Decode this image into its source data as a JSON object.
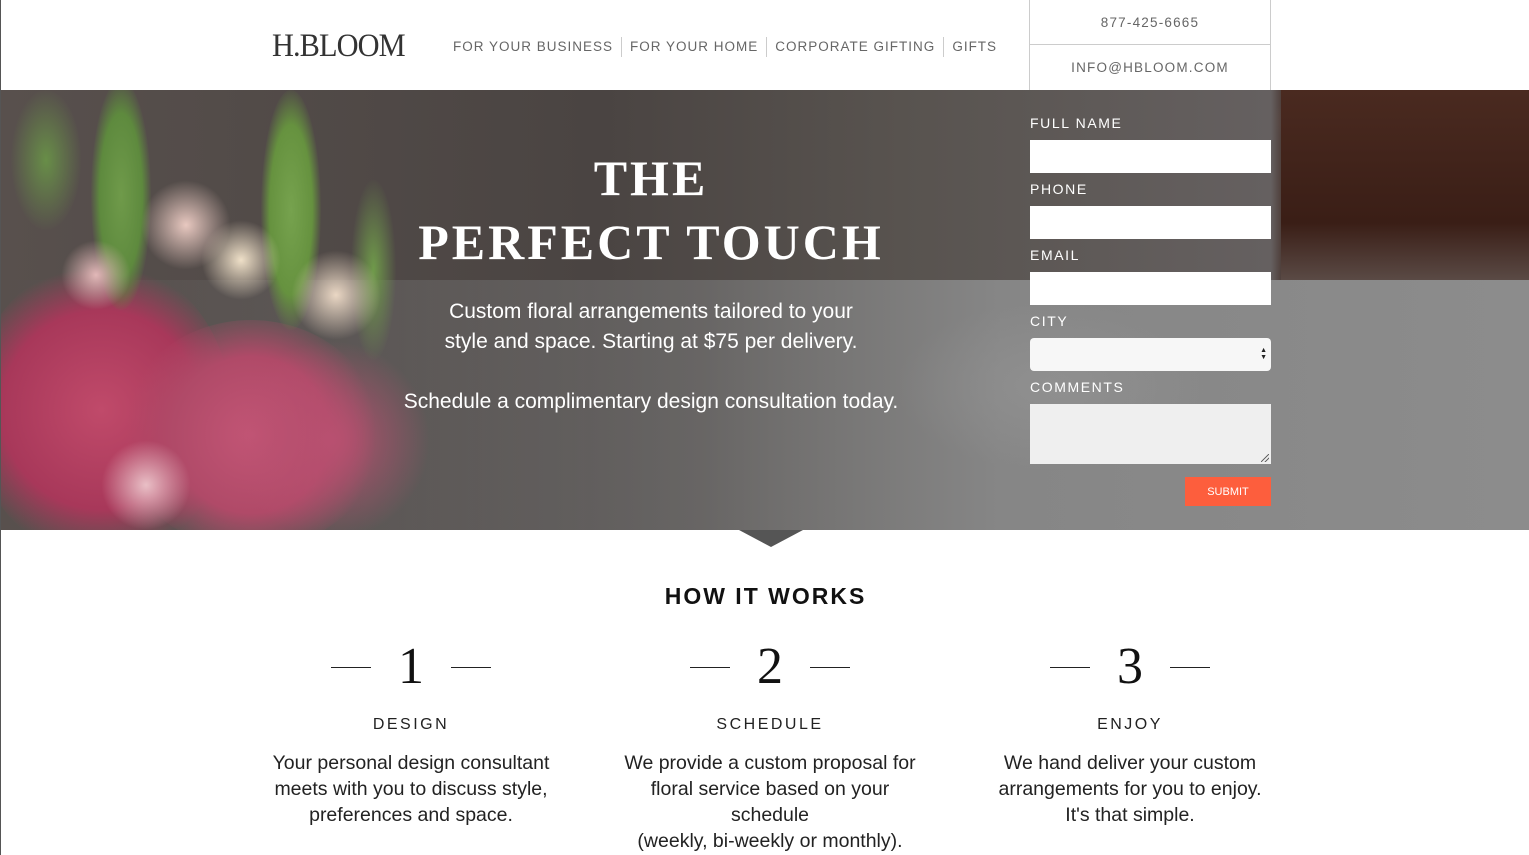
{
  "header": {
    "logo": "H.BLOOM",
    "nav": [
      "FOR YOUR BUSINESS",
      "FOR YOUR HOME",
      "CORPORATE GIFTING",
      "GIFTS"
    ],
    "phone": "877-425-6665",
    "email": "INFO@HBLOOM.COM"
  },
  "hero": {
    "title_line1": "THE",
    "title_line2": "PERFECT TOUCH",
    "text1_line1": "Custom floral arrangements tailored to your",
    "text1_line2": "style and space. Starting at $75 per delivery.",
    "text2": "Schedule a complimentary design consultation today."
  },
  "form": {
    "full_name_label": "FULL NAME",
    "full_name_value": "",
    "phone_label": "PHONE",
    "phone_value": "",
    "email_label": "EMAIL",
    "email_value": "",
    "city_label": "CITY",
    "city_value": "",
    "comments_label": "COMMENTS",
    "comments_value": "",
    "submit_label": "SUBMIT",
    "submit_color": "#fd5e3d"
  },
  "how_it_works": {
    "title": "HOW IT WORKS",
    "steps": [
      {
        "number": "1",
        "title": "DESIGN",
        "desc": [
          "Your personal design consultant",
          "meets with you to discuss style,",
          "preferences and space."
        ]
      },
      {
        "number": "2",
        "title": "SCHEDULE",
        "desc": [
          "We provide a custom proposal for",
          "floral service based on your schedule",
          "(weekly, bi-weekly or monthly)."
        ]
      },
      {
        "number": "3",
        "title": "ENJOY",
        "desc": [
          "We hand deliver your custom",
          "arrangements for you to enjoy.",
          "It's that simple."
        ]
      }
    ]
  }
}
